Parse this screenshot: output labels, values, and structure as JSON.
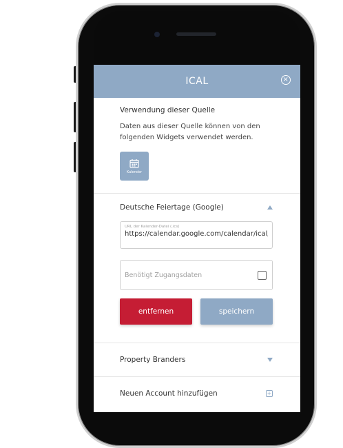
{
  "modal": {
    "title": "ICAL",
    "close_icon": "close-circle-icon",
    "usage_title": "Verwendung dieser Quelle",
    "usage_description": "Daten aus dieser Quelle können von den folgenden Widgets verwendet werden.",
    "widget": {
      "label": "Kalender",
      "icon": "calendar-icon"
    }
  },
  "source": {
    "name": "Deutsche Feiertage (Google)",
    "expanded": true,
    "url_label": "URL der Kalender-Datei (.ics)",
    "url_value": "https://calendar.google.com/calendar/ical/",
    "credentials_label": "Benötigt Zugangsdaten",
    "credentials_checked": false,
    "remove_label": "entfernen",
    "save_label": "speichern"
  },
  "accounts": [
    {
      "name": "Property Branders",
      "icon": "chevron-down-icon"
    },
    {
      "name": "Neuen Account hinzufügen",
      "icon": "plus-square-icon"
    }
  ],
  "colors": {
    "accent": "#8fa9c5",
    "danger": "#c51d34"
  }
}
